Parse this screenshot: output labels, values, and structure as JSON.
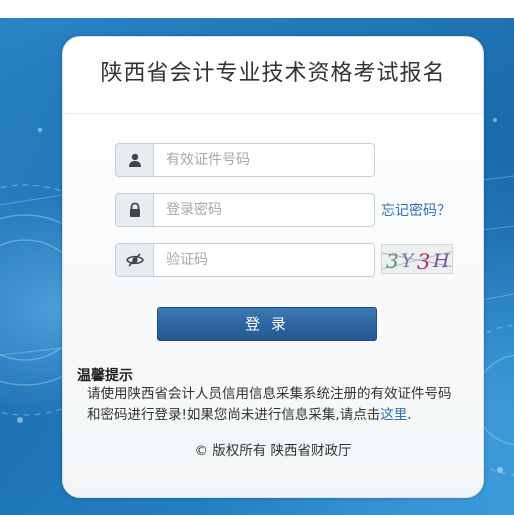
{
  "page": {
    "title": "陕西省会计专业技术资格考试报名"
  },
  "form": {
    "id_number_placeholder": "有效证件号码",
    "password_placeholder": "登录密码",
    "captcha_placeholder": "验证码",
    "forgot_password_label": "忘记密码？",
    "captcha_text": "3Y3H",
    "login_label": "登 录"
  },
  "tips": {
    "title": "温馨提示",
    "body_prefix": "请使用陕西省会计人员信用信息采集系统注册的有效证件号码和密码进行登录!如果您尚未进行信息采集,请点击",
    "link_label": "这里",
    "body_suffix": "."
  },
  "footer": {
    "copyright": "© 版权所有 陕西省财政厅"
  },
  "icons": {
    "user": "user-icon",
    "lock": "lock-icon",
    "eye": "eye-icon"
  },
  "colors": {
    "accent": "#2a72b8",
    "button": "#2d66a0",
    "background": "#1f6aa3"
  }
}
